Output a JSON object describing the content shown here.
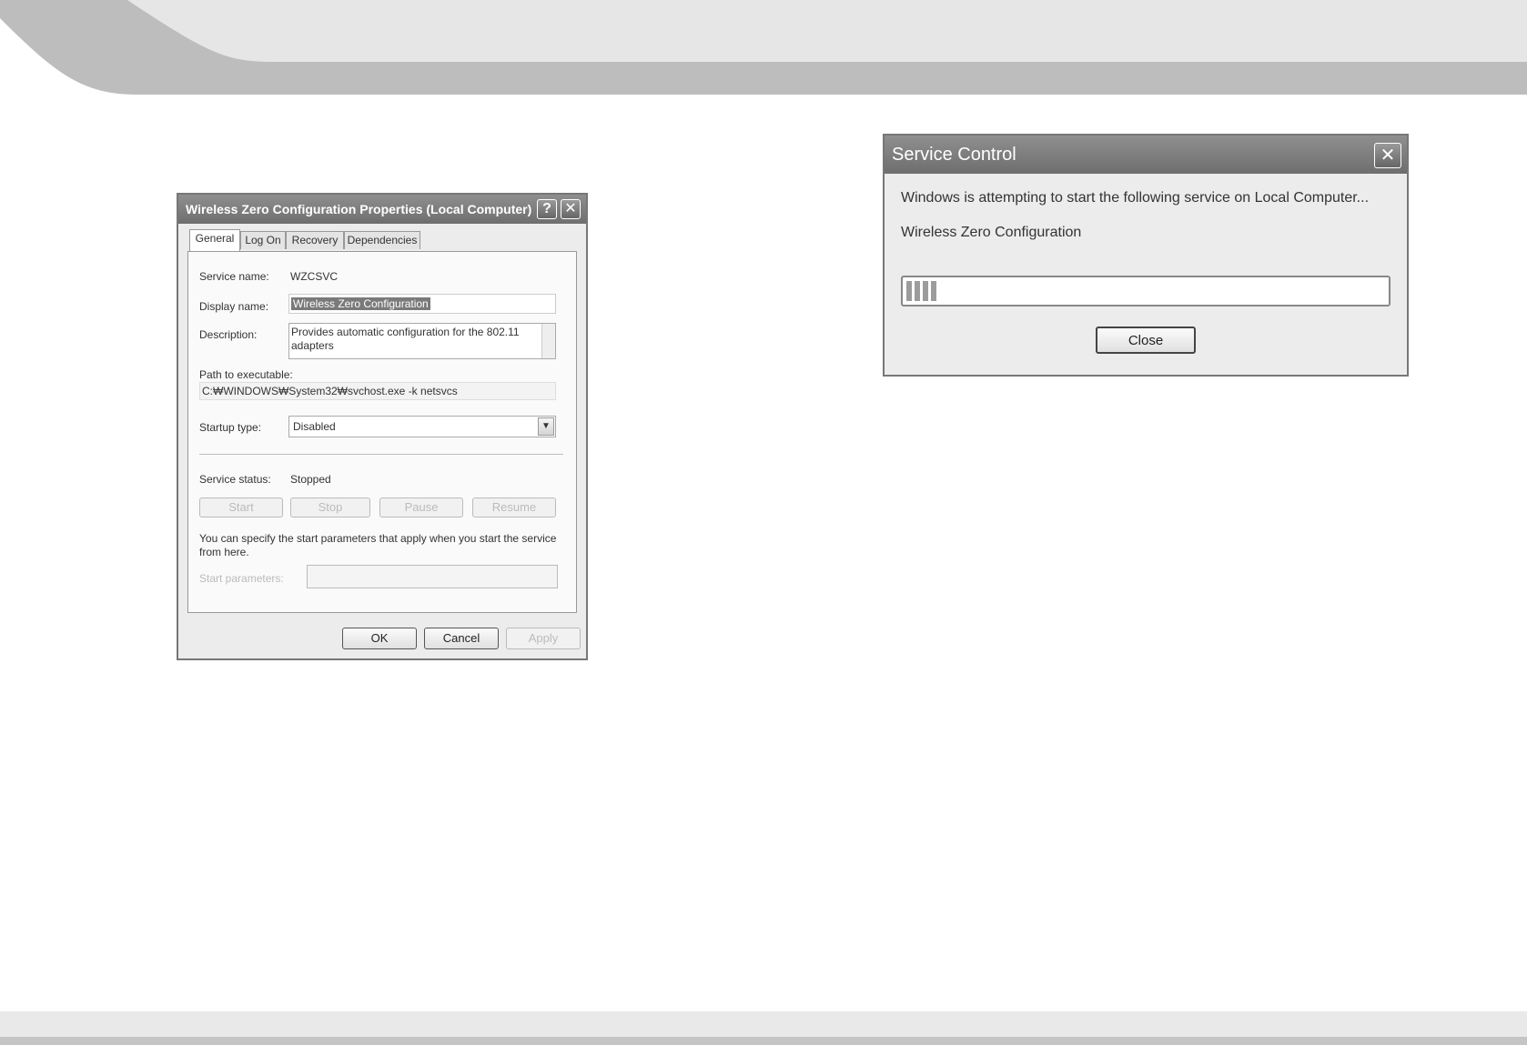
{
  "properties_dialog": {
    "title": "Wireless Zero Configuration Properties (Local Computer)",
    "help_button": "?",
    "close_button": "✕",
    "tabs": [
      {
        "label": "General",
        "active": true
      },
      {
        "label": "Log On",
        "active": false
      },
      {
        "label": "Recovery",
        "active": false
      },
      {
        "label": "Dependencies",
        "active": false
      }
    ],
    "service_name_label": "Service name:",
    "service_name_value": "WZCSVC",
    "display_name_label": "Display name:",
    "display_name_value": "Wireless Zero Configuration",
    "description_label": "Description:",
    "description_value": "Provides automatic configuration for the 802.11 adapters",
    "path_label": "Path to executable:",
    "path_value": "C:₩WINDOWS₩System32₩svchost.exe -k netsvcs",
    "startup_type_label": "Startup type:",
    "startup_type_value": "Disabled",
    "service_status_label": "Service status:",
    "service_status_value": "Stopped",
    "start_button": "Start",
    "stop_button": "Stop",
    "pause_button": "Pause",
    "resume_button": "Resume",
    "hint_text": "You can specify the start parameters that apply when you start the service from here.",
    "start_parameters_label": "Start parameters:",
    "start_parameters_value": "",
    "ok_button": "OK",
    "cancel_button": "Cancel",
    "apply_button": "Apply"
  },
  "service_control_dialog": {
    "title": "Service Control",
    "close_button": "✕",
    "message": "Windows is attempting to start the following service on Local Computer...",
    "service_name": "Wireless Zero Configuration",
    "progress_fraction": 0.08,
    "close_label": "Close"
  },
  "colors": {
    "titlebar": "#7d7d7d",
    "dialog_bg": "#ececec",
    "header_band": "#bdbdbd",
    "footer_band": "#e9e9e9"
  }
}
